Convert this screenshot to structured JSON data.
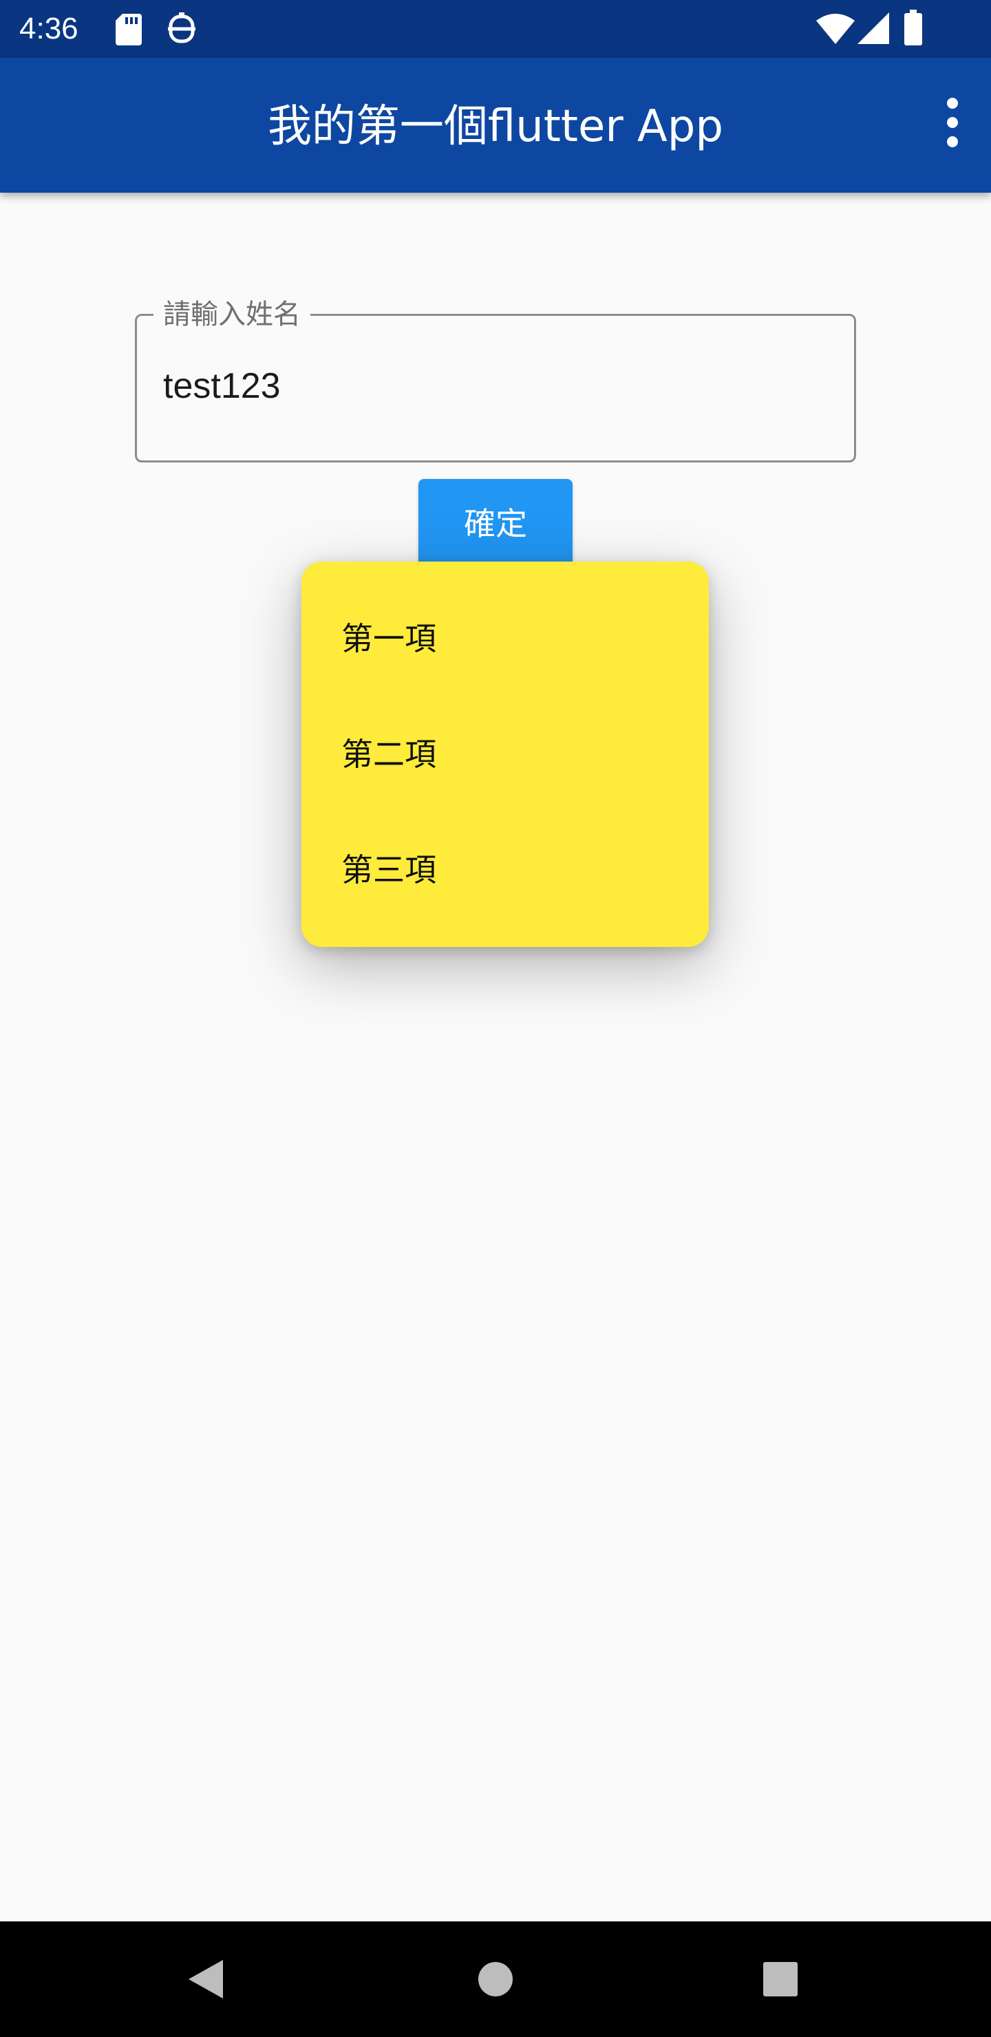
{
  "status_bar": {
    "time": "4:36",
    "icons": [
      "sd-card-icon",
      "face-icon",
      "wifi-icon",
      "cellular-signal-icon",
      "battery-icon"
    ]
  },
  "app_bar": {
    "title": "我的第一個flutter App",
    "menu_icon": "more-vert-icon"
  },
  "form": {
    "name_field": {
      "label": "請輸入姓名",
      "value": "test123"
    },
    "confirm_label": "確定"
  },
  "popup_menu": {
    "background": "#ffeb3b",
    "items": [
      "第一項",
      "第二項",
      "第三項"
    ]
  },
  "nav_bar": {
    "icons": [
      "back-icon",
      "home-icon",
      "recents-icon"
    ]
  },
  "colors": {
    "status_bar": "#0a3580",
    "app_bar": "#0d47a1",
    "button": "#2196f3",
    "menu": "#ffeb3b",
    "background": "#fafafa"
  }
}
